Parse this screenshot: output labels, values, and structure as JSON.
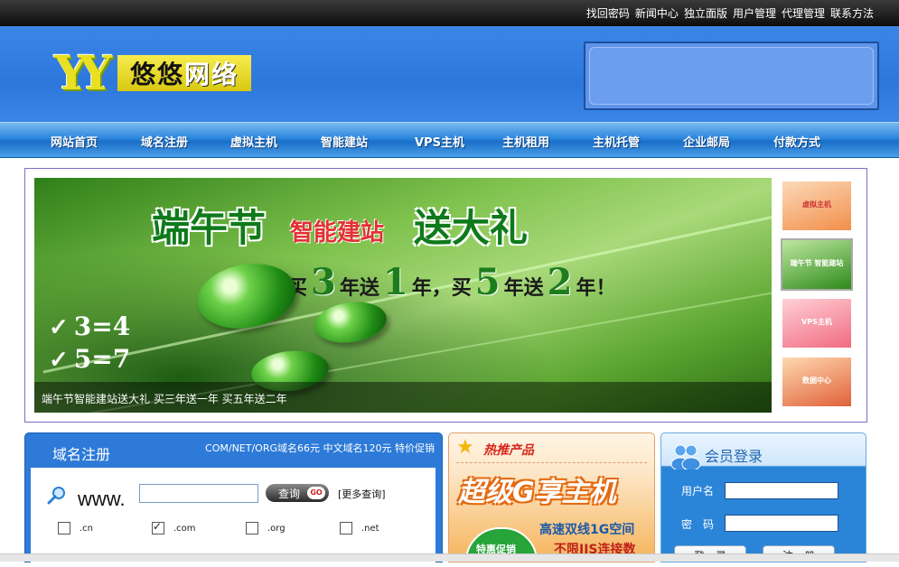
{
  "top_links": [
    "找回密码",
    "新闻中心",
    "独立面版",
    "用户管理",
    "代理管理",
    "联系方法"
  ],
  "logo": {
    "mark": "YY",
    "name_a": "悠悠",
    "name_b": "网络"
  },
  "nav": [
    "网站首页",
    "域名注册",
    "虚拟主机",
    "智能建站",
    "VPS主机",
    "主机租用",
    "主机托管",
    "企业邮局",
    "付款方式"
  ],
  "banner": {
    "title1": "端午节",
    "title2": "智能建站",
    "title3": "送大礼",
    "offer": [
      "买",
      "3",
      "年送",
      "1",
      "年，买",
      "5",
      "年送",
      "2",
      "年！"
    ],
    "eq1": "3=4",
    "eq2": "5=7",
    "caption": "端午节智能建站送大礼 买三年送一年 买五年送二年"
  },
  "thumbs": [
    {
      "label": "虚拟主机",
      "colors": [
        "#fcd9b8",
        "#f28f4a"
      ]
    },
    {
      "label": "端午节 智能建站",
      "colors": [
        "#bfe8a0",
        "#2d8a1a"
      ]
    },
    {
      "label": "VPS主机",
      "colors": [
        "#ffd0d6",
        "#f06b82"
      ]
    },
    {
      "label": "数据中心",
      "colors": [
        "#ffd9b0",
        "#e0613a"
      ]
    }
  ],
  "domain": {
    "title": "域名注册",
    "sub": "COM/NET/ORG域名66元 中文域名120元 特价促销",
    "www": "www.",
    "query": "查询",
    "go": "GO",
    "more": "[更多查询]",
    "tlds": [
      {
        "label": ".cn",
        "checked": false
      },
      {
        "label": ".com",
        "checked": true
      },
      {
        "label": ".org",
        "checked": false
      },
      {
        "label": ".net",
        "checked": false
      }
    ]
  },
  "hot": {
    "title": "热推产品",
    "big": "超级G享主机",
    "line1": "高速双线1G空间",
    "line2": "不限IIS连接数",
    "badge": "特惠促销"
  },
  "login": {
    "title": "会员登录",
    "user_label": "用户名",
    "pass_label": "密　码",
    "btn1": "登　录",
    "btn2": "注　册"
  }
}
